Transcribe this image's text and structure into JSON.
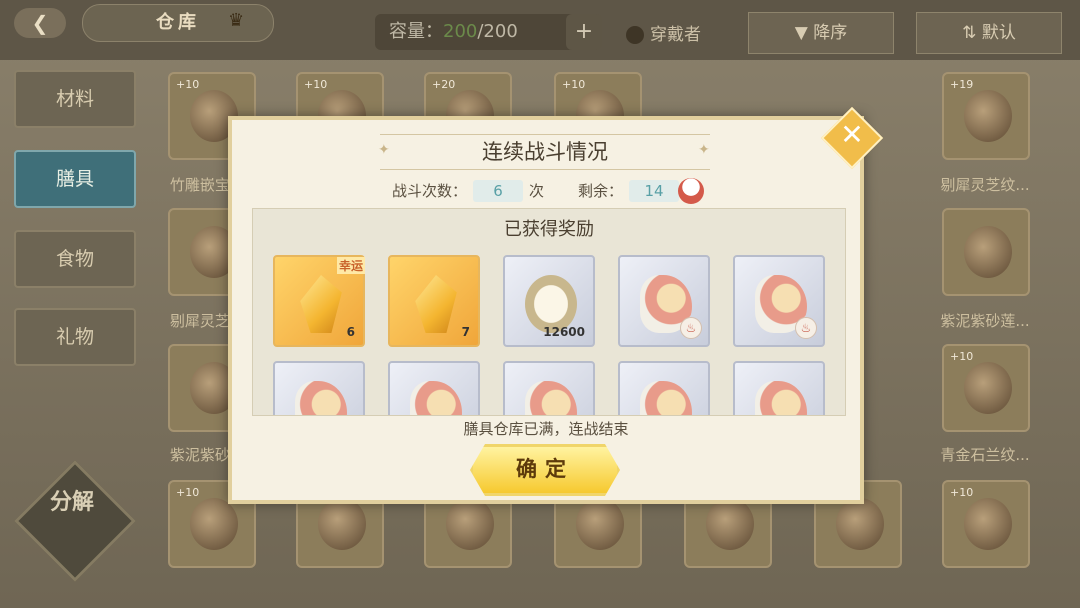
{
  "topbar": {
    "title": "仓库",
    "capacity_label": "容量：",
    "capacity_used": "200",
    "capacity_total": "/200",
    "wearer_label": "穿戴者",
    "sort_desc": "降序",
    "sort_default": "默认"
  },
  "sidebar": {
    "items": [
      {
        "label": "材料"
      },
      {
        "label": "膳具"
      },
      {
        "label": "食物"
      },
      {
        "label": "礼物"
      }
    ],
    "decompose_label": "分解"
  },
  "background_cards": {
    "levels": [
      "+10",
      "+10",
      "+20",
      "+10",
      "+19",
      "+10",
      "+10",
      "+10"
    ],
    "names": [
      "竹雕嵌宝...",
      "剔犀灵芝纹...",
      "剔犀灵芝...",
      "紫泥紫砂莲...",
      "紫泥紫砂...",
      "青金石兰纹..."
    ]
  },
  "modal": {
    "title": "连续战斗情况",
    "battle_count_label": "战斗次数：",
    "battle_count": "6",
    "battle_count_unit": "次",
    "remaining_label": "剩余：",
    "remaining": "14",
    "rewards_title": "已获得奖励",
    "rewards": [
      {
        "type": "gold-crystal",
        "count": "6",
        "tag": "幸运"
      },
      {
        "type": "gold-crystal",
        "count": "7"
      },
      {
        "type": "shell",
        "count": "12600"
      },
      {
        "type": "spoon"
      },
      {
        "type": "spoon"
      },
      {
        "type": "spoon"
      },
      {
        "type": "spoon"
      },
      {
        "type": "spoon"
      },
      {
        "type": "spoon"
      },
      {
        "type": "bowl"
      }
    ],
    "footer_message": "膳具仓库已满，连战结束",
    "confirm_label": "确定",
    "close_icon": "close-icon"
  }
}
